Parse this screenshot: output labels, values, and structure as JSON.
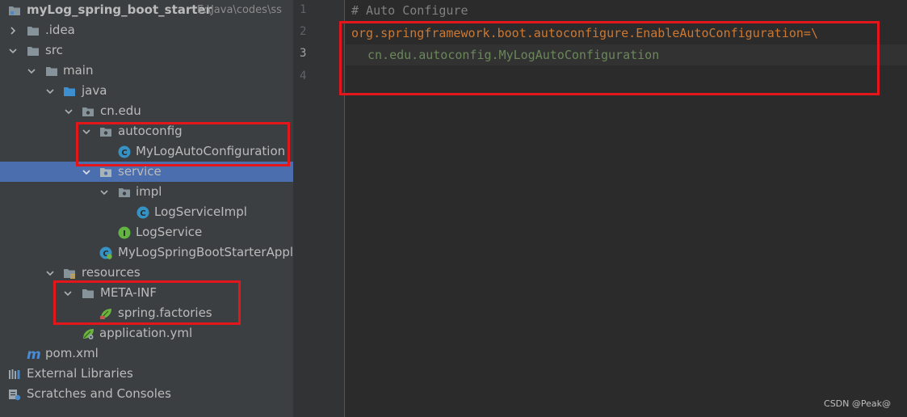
{
  "project_tree": {
    "root": {
      "name": "myLog_spring_boot_starter",
      "path": "E:\\Java\\codes\\ss"
    },
    "items": [
      {
        "label": ".idea",
        "icon": "folder-icon"
      },
      {
        "label": "src",
        "icon": "folder-icon"
      },
      {
        "label": "main",
        "icon": "folder-icon"
      },
      {
        "label": "java",
        "icon": "source-folder-icon"
      },
      {
        "label": "cn.edu",
        "icon": "package-icon"
      },
      {
        "label": "autoconfig",
        "icon": "package-icon"
      },
      {
        "label": "MyLogAutoConfiguration",
        "icon": "class-icon"
      },
      {
        "label": "service",
        "icon": "package-icon"
      },
      {
        "label": "impl",
        "icon": "package-icon"
      },
      {
        "label": "LogServiceImpl",
        "icon": "class-icon"
      },
      {
        "label": "LogService",
        "icon": "interface-icon"
      },
      {
        "label": "MyLogSpringBootStarterAppl",
        "icon": "spring-boot-app-icon"
      },
      {
        "label": "resources",
        "icon": "resources-folder-icon"
      },
      {
        "label": "META-INF",
        "icon": "folder-icon"
      },
      {
        "label": "spring.factories",
        "icon": "spring-leaf-icon"
      },
      {
        "label": "application.yml",
        "icon": "spring-yml-icon"
      },
      {
        "label": "pom.xml",
        "icon": "maven-icon"
      },
      {
        "label": "External Libraries",
        "icon": "libraries-icon"
      },
      {
        "label": "Scratches and Consoles",
        "icon": "scratches-icon"
      }
    ]
  },
  "editor": {
    "line_numbers": [
      "1",
      "2",
      "3",
      "4"
    ],
    "current_line": 3,
    "lines": {
      "comment": "# Auto Configure",
      "key": "org.springframework.boot.autoconfigure.EnableAutoConfiguration=\\",
      "value": "cn.edu.autoconfig.MyLogAutoConfiguration"
    }
  },
  "watermark": "CSDN @Peak@",
  "colors": {
    "selection": "#4b6eaf",
    "annotation_box": "#e3161b",
    "properties_key": "#cc7832",
    "properties_value": "#6a8759"
  }
}
